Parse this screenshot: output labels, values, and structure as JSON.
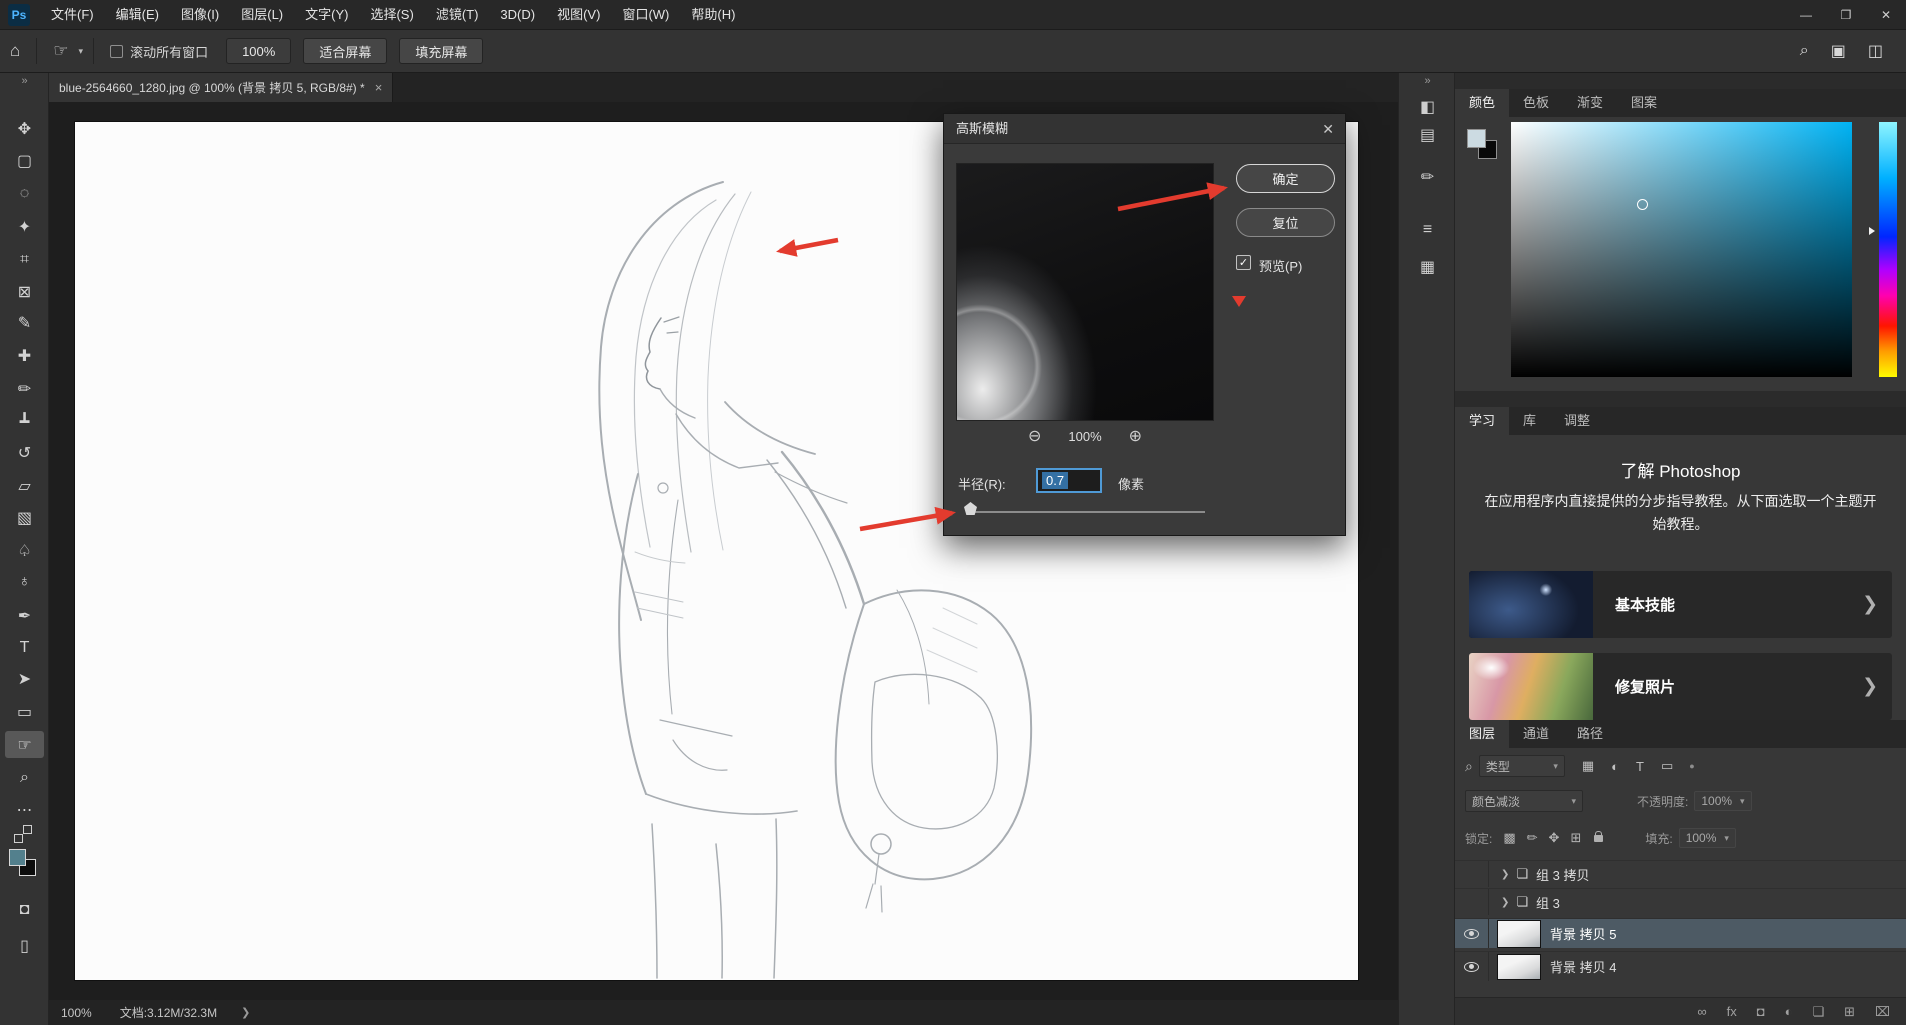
{
  "menubar": {
    "logo": "Ps",
    "items": [
      "文件(F)",
      "编辑(E)",
      "图像(I)",
      "图层(L)",
      "文字(Y)",
      "选择(S)",
      "滤镜(T)",
      "3D(D)",
      "视图(V)",
      "窗口(W)",
      "帮助(H)"
    ],
    "window": {
      "minimize": "—",
      "restore": "❐",
      "close": "✕"
    }
  },
  "optionsbar": {
    "scroll_all_windows": "滚动所有窗口",
    "zoom_button": "100%",
    "fit_screen": "适合屏幕",
    "fill_screen": "填充屏幕"
  },
  "tabbar": {
    "doc_title": "blue-2564660_1280.jpg @ 100% (背景 拷贝 5, RGB/8#) *",
    "close": "×"
  },
  "dialog": {
    "title": "高斯模糊",
    "close": "✕",
    "ok": "确定",
    "reset": "复位",
    "preview": "预览(P)",
    "check": "✓",
    "zoom": "100%",
    "radius_label": "半径(R):",
    "radius_value": "0.7",
    "unit": "像素"
  },
  "color_panel": {
    "tabs": [
      "颜色",
      "色板",
      "渐变",
      "图案"
    ]
  },
  "learn_panel": {
    "tabs": [
      "学习",
      "库",
      "调整"
    ],
    "heading": "了解 Photoshop",
    "body": "在应用程序内直接提供的分步指导教程。从下面选取一个主题开始教程。",
    "cards": [
      {
        "label": "基本技能"
      },
      {
        "label": "修复照片"
      }
    ]
  },
  "layers_panel": {
    "tabs": [
      "图层",
      "通道",
      "路径"
    ],
    "filter_type": "类型",
    "blend_mode": "颜色减淡",
    "opacity_label": "不透明度:",
    "opacity_value": "100%",
    "lock_label": "锁定:",
    "fill_label": "填充:",
    "fill_value": "100%",
    "layers": [
      {
        "name": "组 3 拷贝"
      },
      {
        "name": "组 3"
      },
      {
        "name": "背景 拷贝 5"
      },
      {
        "name": "背景 拷贝 4"
      }
    ]
  },
  "statusbar": {
    "zoom": "100%",
    "doc_info": "文档:3.12M/32.3M",
    "more": "❯"
  },
  "icons": {
    "home": "⌂",
    "caret": "▾",
    "search": "⌕",
    "workspace": "▣",
    "arrange": "◫",
    "tab_overflow": "»",
    "zoom_out": "⊖",
    "zoom_in": "⊕",
    "expand": "❯",
    "chevron": "❯",
    "folder": "❏",
    "quick_mask": "◘",
    "screen_mode": "▯",
    "tools": [
      "✥",
      "▢",
      "◌",
      "✦",
      "⌗",
      "⊠",
      "✎",
      "✚",
      "✏",
      "┻",
      "↺",
      "▱",
      "▧",
      "♤",
      "♁",
      "✒",
      "T",
      "➤",
      "▭",
      "☞",
      "⌕",
      "⋯"
    ],
    "panel_strip": [
      "◧",
      "▤",
      "✏",
      "≡",
      "▦"
    ],
    "filter_row": [
      "▦",
      "◐",
      "T",
      "▭",
      "●"
    ],
    "lock_row": [
      "▩",
      "✏",
      "✥",
      "⊞"
    ],
    "footer": [
      "∞",
      "fx",
      "◘",
      "◐",
      "❏",
      "⊞",
      "⌧"
    ]
  },
  "colors": {
    "accent": "#4f9ad6",
    "arrow": "#e33b2e",
    "fg_swatch": "#53808d"
  }
}
